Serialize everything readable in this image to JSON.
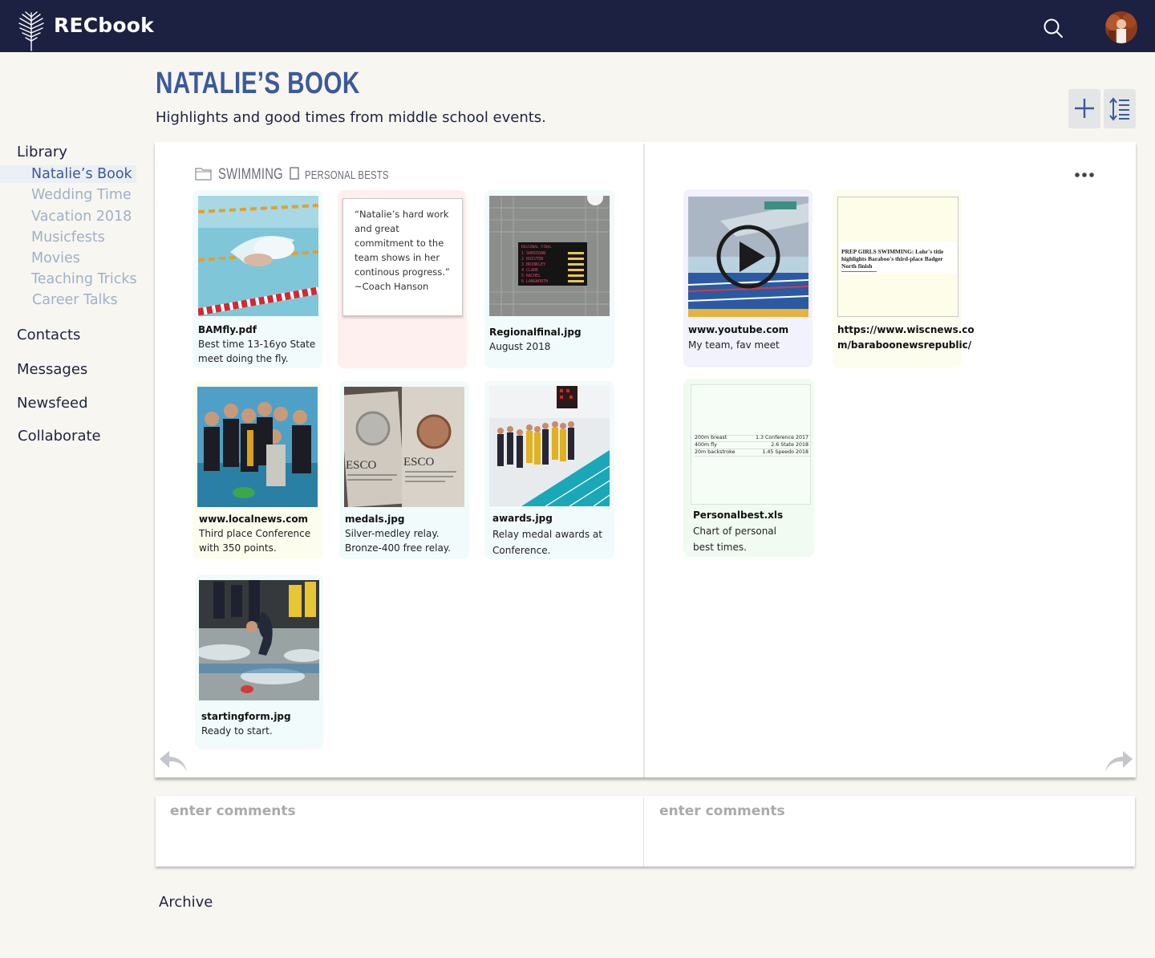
{
  "app": {
    "brand": "RECbook",
    "logo_icon": "palm-leaf-icon"
  },
  "header": {
    "title": "NATALIE’S BOOK",
    "subtitle": "Highlights and good times from middle school events.",
    "add_icon": "plus-icon",
    "sort_icon": "line-spacing-icon"
  },
  "sidebar": {
    "library": "Library",
    "books": [
      {
        "label": "Natalie’s Book",
        "active": true
      },
      {
        "label": "Wedding Time"
      },
      {
        "label": "Vacation 2018"
      },
      {
        "label": "Musicfests"
      },
      {
        "label": "Movies"
      },
      {
        "label": "Teaching Tricks"
      },
      {
        "label": "Career Talks"
      }
    ],
    "contacts": "Contacts",
    "messages": "Messages",
    "newsfeed": "Newsfeed",
    "collaborate": "Collaborate",
    "archive": "Archive"
  },
  "book": {
    "breadcrumb": {
      "folder": "SWIMMING",
      "page": "PERSONAL BESTS"
    },
    "left_cards": [
      {
        "title": "BAMfly.pdf",
        "desc": "Best time 13-16yo State meet doing the fly."
      },
      {
        "quote": "“Natalie’s hard work and great commitment to the team shows in her continous progress.” ~Coach Hanson"
      },
      {
        "title": "Regionalfinal.jpg",
        "desc": "August 2018"
      },
      {
        "title": "www.localnews.com",
        "desc": "Third place Conference with 350 points."
      },
      {
        "title": "medals.jpg",
        "desc": "Silver-medley relay. Bronze-400 free relay."
      },
      {
        "title": "awards.jpg",
        "desc": "Relay medal awards at Conference."
      },
      {
        "title": "startingform.jpg",
        "desc": "Ready to start."
      }
    ],
    "right_cards": [
      {
        "title": "www.youtube.com",
        "desc": "My team, fav meet"
      },
      {
        "title": "https://www.wiscnews.co m/baraboonewsrepublic/",
        "headline": "PREP GIRLS SWIMMING: Lohr's title highlights Baraboo's third-place Badger North finish"
      },
      {
        "title": "Personalbest.xls",
        "desc": "Chart of personal best times.",
        "sheet_rows": [
          [
            "200m breast",
            "1.3 Conference 2017"
          ],
          [
            "400m fly",
            "2.6 State 2018"
          ],
          [
            "20m backstroke",
            "1.45 Speedo 2018"
          ]
        ]
      }
    ],
    "scoreboard": {
      "header": "REGIONAL FINAL",
      "rows": [
        "1 SHERIDAN",
        "2 KRISTEN",
        "3 BRINKLEY",
        "4 CLARK",
        "5 RACHEL",
        "6 LANGWORTH"
      ]
    },
    "medal_brand": "ESCO"
  },
  "comments": {
    "left_placeholder": "enter comments",
    "right_placeholder": "enter comments"
  },
  "colors": {
    "nav": "#1c2041",
    "title": "#3a5a9b",
    "sidebar_muted": "#9fb0c8"
  }
}
